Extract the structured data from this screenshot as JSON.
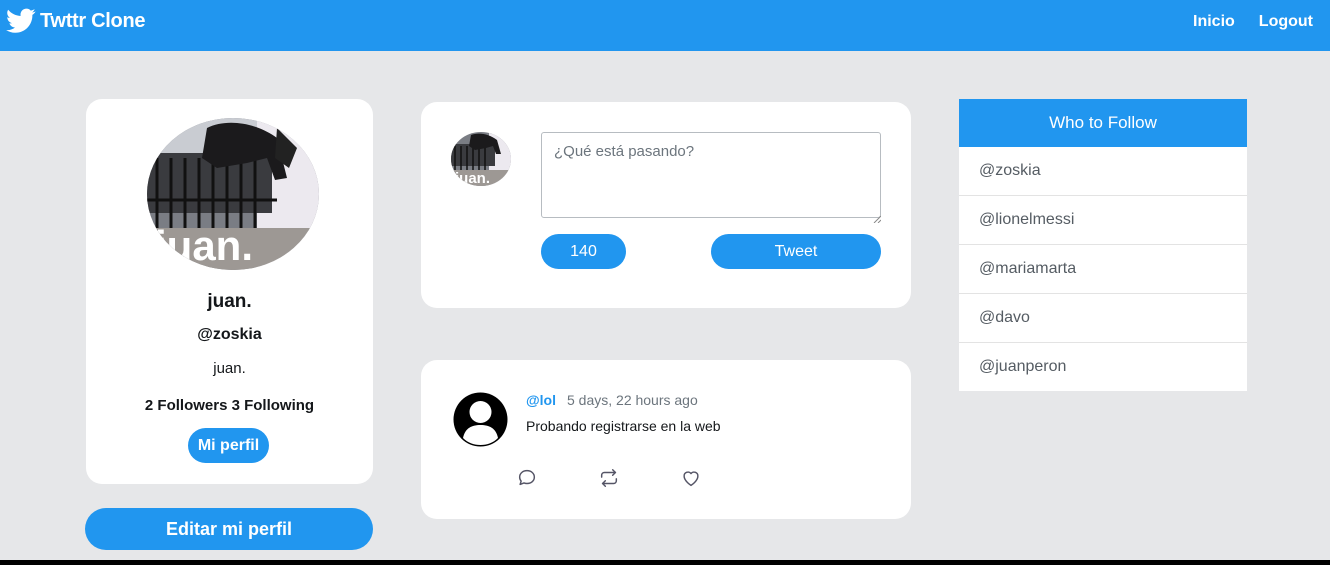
{
  "navbar": {
    "brand": "Twttr Clone",
    "links": [
      "Inicio",
      "Logout"
    ],
    "color": "#2196ef"
  },
  "profile": {
    "avatar_caption": "juan.",
    "name": "juan.",
    "handle": "@zoskia",
    "bio": "juan.",
    "follow_stats": "2 Followers 3 Following",
    "my_profile_button": "Mi perfil",
    "edit_button": "Editar mi perfil"
  },
  "compose": {
    "avatar_caption": "juan.",
    "placeholder": "¿Qué está pasando?",
    "counter": "140",
    "tweet_button": "Tweet"
  },
  "tweets": [
    {
      "author": "@lol",
      "time": "5 days, 22 hours ago",
      "text": "Probando registrarse en la web",
      "actions": [
        "comment-icon",
        "retweet-icon",
        "heart-icon"
      ]
    }
  ],
  "who_to_follow": {
    "title": "Who to Follow",
    "users": [
      "@zoskia",
      "@lionelmessi",
      "@mariamarta",
      "@davo",
      "@juanperon"
    ]
  }
}
